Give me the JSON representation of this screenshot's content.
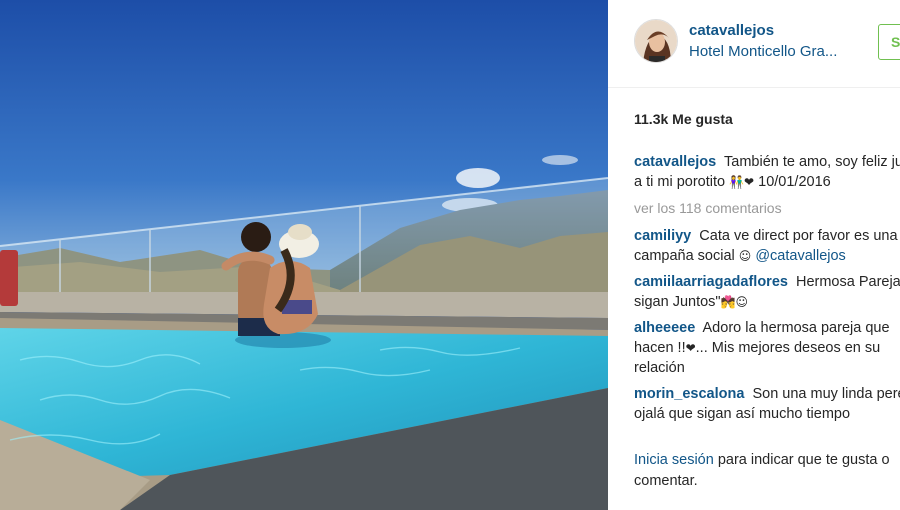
{
  "post": {
    "username": "catavallejos",
    "location": "Hotel Monticello Gra...",
    "follow_label": "Seguir",
    "likes": "11.3k Me gusta"
  },
  "caption": {
    "user": "catavallejos",
    "text": "También te amo, soy feliz junto a ti mi porotito",
    "emoji": "👫❤",
    "date": "10/01/2016"
  },
  "view_all_label": "ver los 118 comentarios",
  "comments": [
    {
      "user": "camiliyy",
      "text": "Cata ve direct por favor es una campaña social",
      "emoji": "☺",
      "mention": "@catavallejos"
    },
    {
      "user": "camiilaarriagadaflores",
      "text_a": "Hermosa Pareja",
      "emoji_a": "❤❤",
      "text_b": "sigan Juntos\"",
      "emoji_b": "💏☺"
    },
    {
      "user": "alheeeee",
      "text_a": "Adoro la hermosa pareja que hacen !!",
      "emoji": "❤",
      "text_b": "... Mis mejores deseos en su relación"
    },
    {
      "user": "morin_escalona",
      "text": "Son una muy linda pereja ojalá que sigan así mucho tiempo"
    }
  ],
  "footer": {
    "login_label": "Inicia sesión",
    "rest": "para indicar que te gusta o comentar."
  },
  "colors": {
    "link": "#125688",
    "follow": "#70c050",
    "muted": "#999999"
  }
}
